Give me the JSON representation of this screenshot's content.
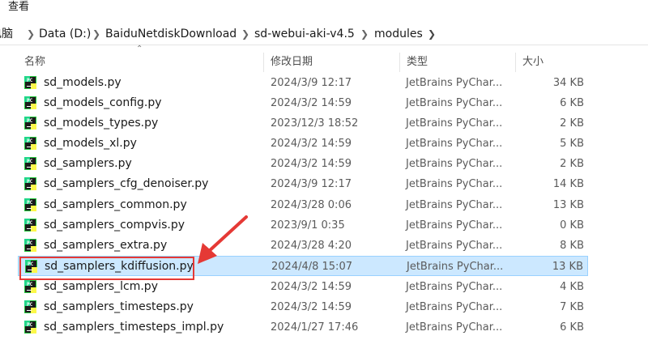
{
  "menu": {
    "view_label": "查看"
  },
  "breadcrumb": {
    "items": [
      "电脑",
      "Data (D:)",
      "BaiduNetdiskDownload",
      "sd-webui-aki-v4.5",
      "modules"
    ]
  },
  "columns": {
    "name": "名称",
    "date": "修改日期",
    "type": "类型",
    "size": "大小"
  },
  "files": [
    {
      "name": "sd_models.py",
      "date": "2024/3/9 12:17",
      "type": "JetBrains PyChar...",
      "size": "34 KB"
    },
    {
      "name": "sd_models_config.py",
      "date": "2024/3/2 14:59",
      "type": "JetBrains PyChar...",
      "size": "6 KB"
    },
    {
      "name": "sd_models_types.py",
      "date": "2023/12/3 18:52",
      "type": "JetBrains PyChar...",
      "size": "2 KB"
    },
    {
      "name": "sd_models_xl.py",
      "date": "2024/3/2 14:59",
      "type": "JetBrains PyChar...",
      "size": "5 KB"
    },
    {
      "name": "sd_samplers.py",
      "date": "2024/3/2 14:59",
      "type": "JetBrains PyChar...",
      "size": "2 KB"
    },
    {
      "name": "sd_samplers_cfg_denoiser.py",
      "date": "2024/3/9 12:17",
      "type": "JetBrains PyChar...",
      "size": "14 KB"
    },
    {
      "name": "sd_samplers_common.py",
      "date": "2024/3/28 0:06",
      "type": "JetBrains PyChar...",
      "size": "13 KB"
    },
    {
      "name": "sd_samplers_compvis.py",
      "date": "2023/9/1 0:35",
      "type": "JetBrains PyChar...",
      "size": "0 KB"
    },
    {
      "name": "sd_samplers_extra.py",
      "date": "2024/3/28 4:20",
      "type": "JetBrains PyChar...",
      "size": "8 KB"
    },
    {
      "name": "sd_samplers_kdiffusion.py",
      "date": "2024/4/8 15:07",
      "type": "JetBrains PyChar...",
      "size": "13 KB",
      "selected": true
    },
    {
      "name": "sd_samplers_lcm.py",
      "date": "2024/3/2 14:59",
      "type": "JetBrains PyChar...",
      "size": "4 KB"
    },
    {
      "name": "sd_samplers_timesteps.py",
      "date": "2024/3/2 14:59",
      "type": "JetBrains PyChar...",
      "size": "7 KB"
    },
    {
      "name": "sd_samplers_timesteps_impl.py",
      "date": "2024/1/27 17:46",
      "type": "JetBrains PyChar...",
      "size": "6 KB"
    }
  ],
  "icons": {
    "file": "pycharm-file-icon"
  },
  "colors": {
    "selection": "#cce8ff",
    "annotation": "#e53935"
  }
}
